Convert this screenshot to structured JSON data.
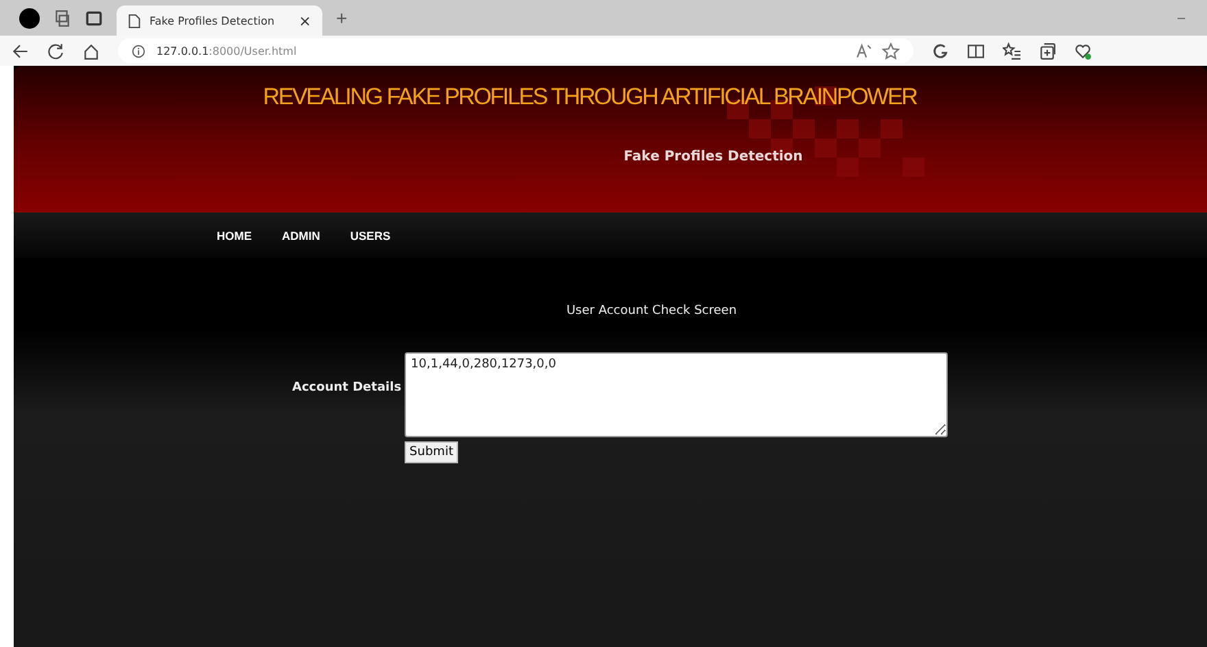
{
  "browser": {
    "tab_title": "Fake Profiles Detection",
    "tab_close": "×",
    "new_tab": "+",
    "url_host": "127.0.0.1",
    "url_rest": ":8000/User.html",
    "minimize": "–"
  },
  "header": {
    "title": "REVEALING FAKE PROFILES THROUGH ARTIFICIAL BRAINPOWER",
    "subtitle": "Fake Profiles Detection"
  },
  "nav": [
    {
      "label": "HOME"
    },
    {
      "label": "ADMIN"
    },
    {
      "label": "USERS"
    }
  ],
  "form": {
    "heading": "User Account Check Screen",
    "label": "Account Details",
    "value": "10,1,44,0,280,1273,0,0",
    "button": "Submit"
  }
}
